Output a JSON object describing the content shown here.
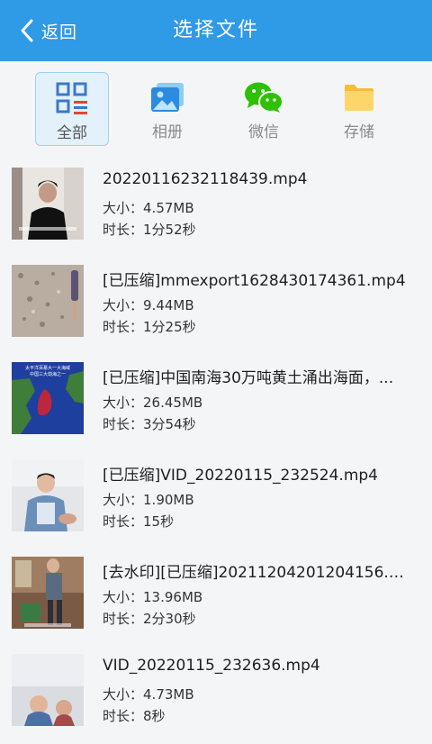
{
  "header": {
    "back_label": "返回",
    "title": "选择文件",
    "color": "#2f9ae6"
  },
  "tabs": [
    {
      "label": "全部",
      "icon": "grid-list-icon",
      "active": true
    },
    {
      "label": "相册",
      "icon": "photo-album-icon",
      "active": false
    },
    {
      "label": "微信",
      "icon": "wechat-icon",
      "active": false
    },
    {
      "label": "存储",
      "icon": "folder-icon",
      "active": false
    }
  ],
  "size_prefix": "大小：",
  "duration_prefix": "时长：",
  "files": [
    {
      "name": "20220116232118439.mp4",
      "size": "4.57MB",
      "duration": "1分52秒",
      "thumb_caption": "",
      "thumb_overlay": ""
    },
    {
      "name": "[已压缩]mmexport1628430174361.mp4",
      "size": "9.44MB",
      "duration": "1分25秒",
      "thumb_caption": "",
      "thumb_overlay": ""
    },
    {
      "name": "[已压缩]中国南海30万吨黄土涌出海面，...",
      "size": "26.45MB",
      "duration": "3分54秒",
      "thumb_caption": "太平洋百慕大一大海域",
      "thumb_overlay": "中国三大劫海之一"
    },
    {
      "name": "[已压缩]VID_20220115_232524.mp4",
      "size": "1.90MB",
      "duration": "15秒",
      "thumb_caption": "",
      "thumb_overlay": ""
    },
    {
      "name": "[去水印][已压缩]20211204201204156.m...",
      "size": "13.96MB",
      "duration": "2分30秒",
      "thumb_caption": "",
      "thumb_overlay": ""
    },
    {
      "name": "VID_20220115_232636.mp4",
      "size": "4.73MB",
      "duration": "8秒",
      "thumb_caption": "",
      "thumb_overlay": ""
    }
  ]
}
